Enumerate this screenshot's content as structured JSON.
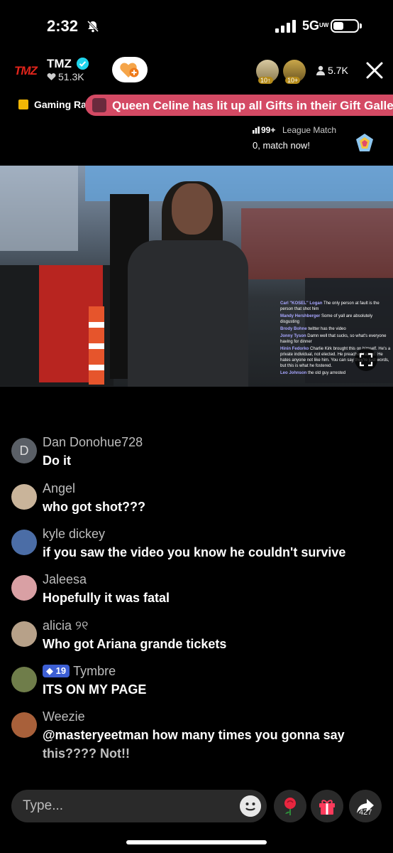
{
  "status": {
    "time": "2:32",
    "network": "5G",
    "network_sub": "UW"
  },
  "header": {
    "logo": "TMZ",
    "host_name": "TMZ",
    "likes": "51.3K",
    "gift_badge_1": "10↑",
    "gift_badge_2": "10+",
    "viewers": "5.7K"
  },
  "ranking": {
    "label": "Gaming Ra",
    "gift_banner": "Queen Celine has lit up all Gifts in their Gift Galle"
  },
  "league": {
    "count": "99+",
    "label": "League Match",
    "cta": "0, match now!"
  },
  "video_chat": [
    {
      "name": "Carl \"KOSEL\" Logan",
      "text": "The only person at fault is the person that shot him"
    },
    {
      "name": "Mandy Hershberger",
      "text": "Some of yall are absolutely disgusting"
    },
    {
      "name": "Brody Bohne",
      "text": "twitter has the video"
    },
    {
      "name": "Jonny Tyson",
      "text": "Damn well that sucks, so what's everyone having for dinner"
    },
    {
      "name": "Hinin Fedorko",
      "text": "Charlie Kirk brought this on himself. He's a private individual, not elected. He preached hatred. He hates anyone not like him. You can say they're just words, but this is what he fostered."
    },
    {
      "name": "Leo Johnson",
      "text": "the old guy arrested"
    }
  ],
  "comments": [
    {
      "name": "Dan Donohue728",
      "text": "Do it",
      "avatar_color": "#5a5f66",
      "initial": "D"
    },
    {
      "name": "Angel",
      "text": "who got shot???",
      "avatar_color": "#c9b49a",
      "initial": ""
    },
    {
      "name": "kyle dickey",
      "text": "if you saw the video you know he couldn't survive",
      "avatar_color": "#4b6da6",
      "initial": ""
    },
    {
      "name": "Jaleesa",
      "text": "Hopefully it was fatal",
      "avatar_color": "#d9a0a4",
      "initial": ""
    },
    {
      "name": "alicia ୨୧",
      "text": "Who got Ariana grande tickets",
      "avatar_color": "#b7a189",
      "initial": ""
    },
    {
      "name": "Tymbre",
      "badge": "19",
      "text": "ITS ON MY PAGE",
      "avatar_color": "#6f7d4a",
      "initial": ""
    },
    {
      "name": "Weezie",
      "text": "@masteryeetman how many times you gonna say",
      "text2": "this???? Not!!",
      "avatar_color": "#a8603a",
      "initial": ""
    }
  ],
  "bottom": {
    "placeholder": "Type...",
    "share_count": "427"
  },
  "colors": {
    "accent_red": "#e0241b",
    "banner_pink": "#d44a64",
    "verified_blue": "#20d5ec"
  }
}
